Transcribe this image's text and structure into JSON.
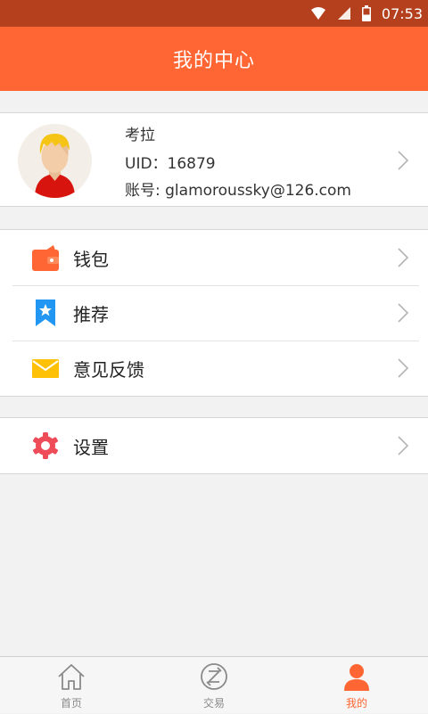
{
  "status_bar": {
    "time": "07:53"
  },
  "header": {
    "title": "我的中心"
  },
  "profile": {
    "name": "考拉",
    "uid": "UID：16879",
    "account": "账号: glamoroussky@126.com"
  },
  "menu": {
    "wallet": "钱包",
    "recommend": "推荐",
    "feedback": "意见反馈",
    "settings": "设置"
  },
  "tabs": {
    "home": "首页",
    "trade": "交易",
    "mine": "我的"
  },
  "colors": {
    "accent": "#ff6633",
    "status_bar": "#b4401e",
    "wallet": "#ff6633",
    "recommend": "#2196f3",
    "feedback": "#ffc107",
    "settings": "#ef4c5a"
  }
}
